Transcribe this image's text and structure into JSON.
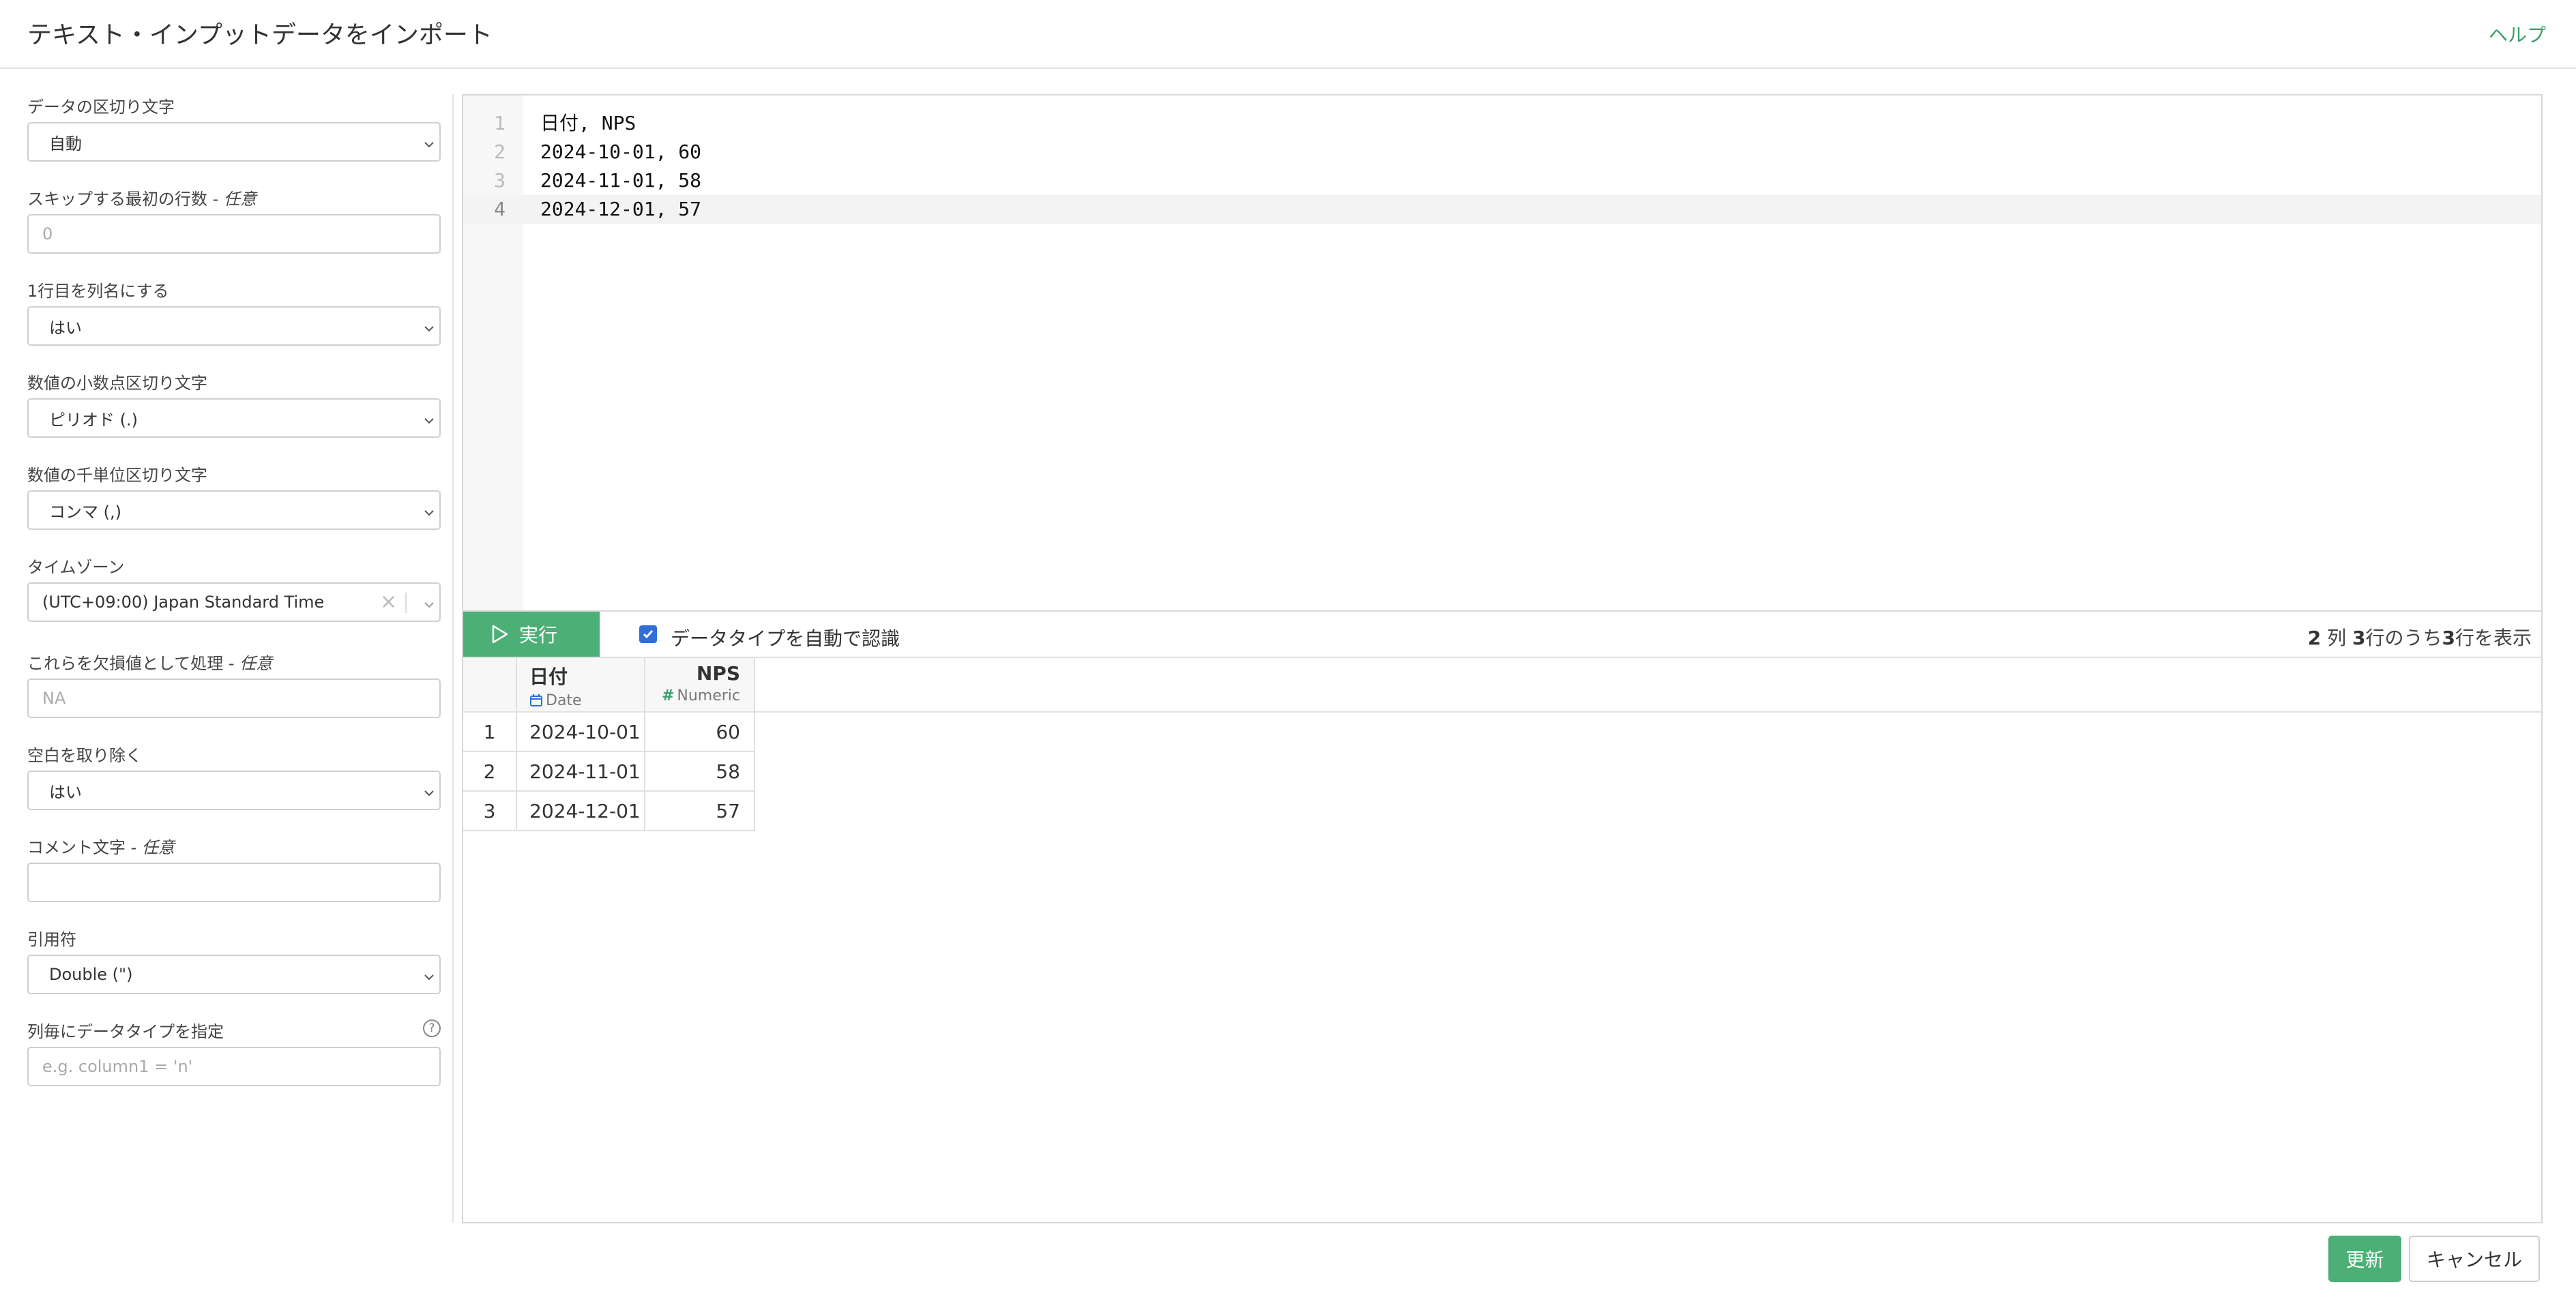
{
  "header": {
    "title": "テキスト・インプットデータをインポート",
    "help": "ヘルプ"
  },
  "settings": {
    "delimiter": {
      "label": "データの区切り文字",
      "value": "自動"
    },
    "skip_rows": {
      "label": "スキップする最初の行数 - ",
      "optional": "任意",
      "placeholder": "0"
    },
    "header_row": {
      "label": "1行目を列名にする",
      "value": "はい"
    },
    "decimal_mark": {
      "label": "数値の小数点区切り文字",
      "value": "ピリオド (.)"
    },
    "grouping_mark": {
      "label": "数値の千単位区切り文字",
      "value": "コンマ (,)"
    },
    "timezone": {
      "label": "タイムゾーン",
      "value": "(UTC+09:00) Japan Standard Time",
      "clear": "×"
    },
    "na_values": {
      "label": "これらを欠損値として処理 - ",
      "optional": "任意",
      "placeholder": "NA"
    },
    "trim_ws": {
      "label": "空白を取り除く",
      "value": "はい"
    },
    "comment": {
      "label": "コメント文字 - ",
      "optional": "任意",
      "placeholder": ""
    },
    "quote": {
      "label": "引用符",
      "value": "Double (\")"
    },
    "col_types": {
      "label": "列毎にデータタイプを指定",
      "help": "?",
      "placeholder": "e.g. column1 = 'n'"
    }
  },
  "editor": {
    "lines": [
      {
        "num": "1",
        "text": "日付, NPS"
      },
      {
        "num": "2",
        "text": "2024-10-01, 60"
      },
      {
        "num": "3",
        "text": "2024-11-01, 58"
      },
      {
        "num": "4",
        "text": "2024-12-01, 57"
      }
    ],
    "active_line": 4
  },
  "toolbar": {
    "run_label": "実行",
    "auto_detect_label": "データタイプを自動で認識",
    "auto_detect_checked": true,
    "cols": "2",
    "cols_unit": "列",
    "total_rows": "3",
    "of_text": "行のうち",
    "shown_rows": "3",
    "shown_text": "行を表示"
  },
  "grid": {
    "columns": [
      {
        "name": "日付",
        "type": "Date",
        "icon": "calendar-icon"
      },
      {
        "name": "NPS",
        "type": "Numeric",
        "icon": "hash-icon"
      }
    ],
    "rows": [
      {
        "idx": "1",
        "date": "2024-10-01",
        "nps": "60"
      },
      {
        "idx": "2",
        "date": "2024-11-01",
        "nps": "58"
      },
      {
        "idx": "3",
        "date": "2024-12-01",
        "nps": "57"
      }
    ]
  },
  "footer": {
    "update_label": "更新",
    "cancel_label": "キャンセル"
  },
  "colors": {
    "accent_green": "#4caf75",
    "checkbox_blue": "#2f6fd6",
    "link_green": "#3aa06a"
  }
}
